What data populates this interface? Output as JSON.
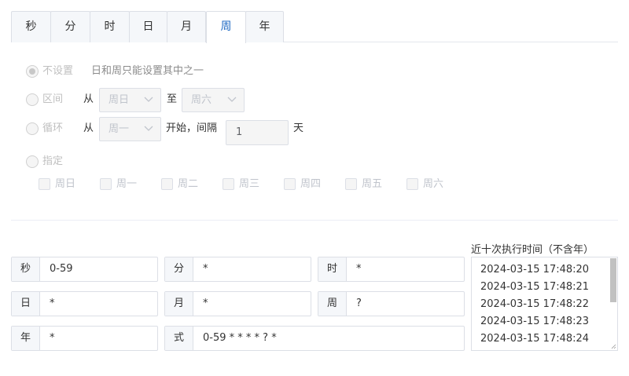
{
  "tabs": [
    "秒",
    "分",
    "时",
    "日",
    "月",
    "周",
    "年"
  ],
  "active_tab": "周",
  "options": {
    "unset_label": "不设置",
    "unset_hint": "日和周只能设置其中之一",
    "range_label": "区间",
    "range_from_word": "从",
    "range_from_value": "周日",
    "range_to_word": "至",
    "range_to_value": "周六",
    "loop_label": "循环",
    "loop_from_word": "从",
    "loop_from_value": "周一",
    "loop_start_text": "开始，间隔",
    "loop_interval_value": "1",
    "loop_unit": "天",
    "specify_label": "指定",
    "weekdays": [
      "周日",
      "周一",
      "周二",
      "周三",
      "周四",
      "周五",
      "周六"
    ]
  },
  "fields": {
    "second": {
      "prefix": "秒",
      "value": "0-59"
    },
    "minute": {
      "prefix": "分",
      "value": "*"
    },
    "hour": {
      "prefix": "时",
      "value": "*"
    },
    "day": {
      "prefix": "日",
      "value": "*"
    },
    "month": {
      "prefix": "月",
      "value": "*"
    },
    "week": {
      "prefix": "周",
      "value": "?"
    },
    "year": {
      "prefix": "年",
      "value": "*"
    },
    "expression": {
      "prefix": "式",
      "value": "0-59 * * * * ? *"
    }
  },
  "recent": {
    "title": "近十次执行时间（不含年）",
    "items": [
      "2024-03-15 17:48:20",
      "2024-03-15 17:48:21",
      "2024-03-15 17:48:22",
      "2024-03-15 17:48:23",
      "2024-03-15 17:48:24"
    ]
  },
  "colors": {
    "active_tab": "#1f6ac4",
    "border": "#dcdfe6",
    "disabled_text": "#bfbfbf"
  }
}
